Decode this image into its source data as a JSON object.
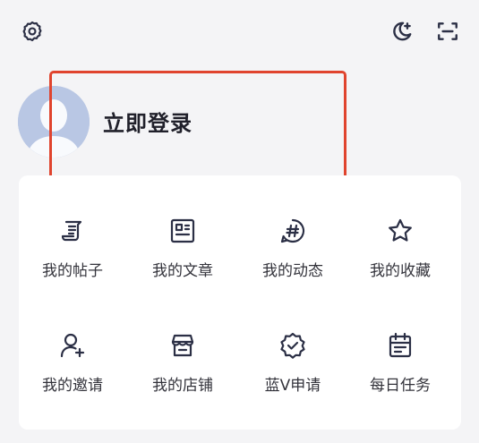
{
  "topbar": {
    "left_icon": "gear-icon",
    "right_icons": [
      "moon-plus-icon",
      "scan-icon"
    ]
  },
  "profile": {
    "avatar_icon": "default-avatar",
    "login_label": "立即登录"
  },
  "menu": {
    "items": [
      {
        "label": "我的帖子",
        "icon": "post-icon"
      },
      {
        "label": "我的文章",
        "icon": "article-icon"
      },
      {
        "label": "我的动态",
        "icon": "hashtag-icon"
      },
      {
        "label": "我的收藏",
        "icon": "star-icon"
      },
      {
        "label": "我的邀请",
        "icon": "user-plus-icon"
      },
      {
        "label": "我的店铺",
        "icon": "shop-icon"
      },
      {
        "label": "蓝V申请",
        "icon": "verified-badge-icon"
      },
      {
        "label": "每日任务",
        "icon": "calendar-task-icon"
      }
    ]
  },
  "colors": {
    "background": "#f4f4f6",
    "card": "#ffffff",
    "highlight": "#e0442e",
    "avatar": "#b9c7e4",
    "icon": "#2b2f45"
  }
}
